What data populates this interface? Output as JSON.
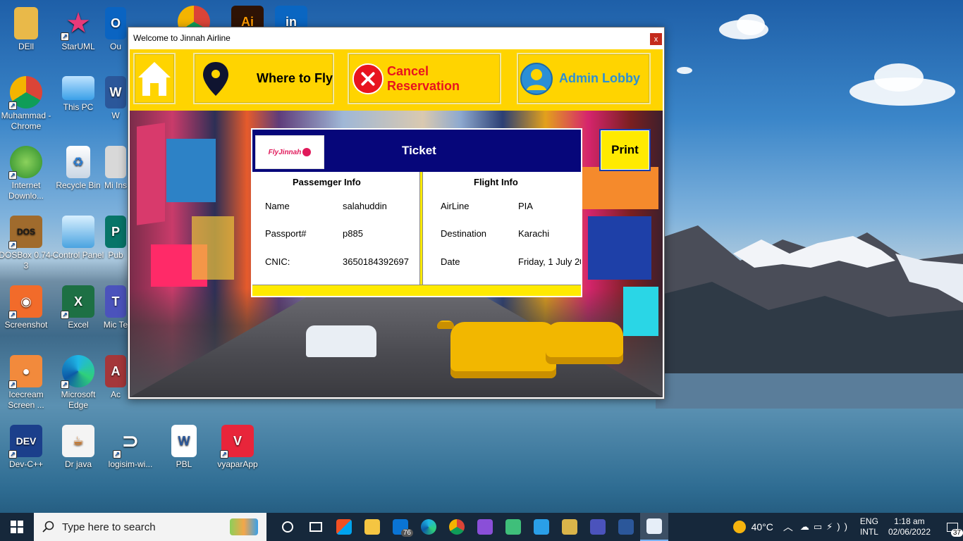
{
  "desktop": {
    "icons": [
      {
        "label": "DEll"
      },
      {
        "label": "StarUML"
      },
      {
        "label": "Ou"
      },
      {
        "label": "Muhammad - Chrome"
      },
      {
        "label": "This PC"
      },
      {
        "label": "W"
      },
      {
        "label": "Internet Downlo..."
      },
      {
        "label": "Recycle Bin"
      },
      {
        "label": "Mi Ins"
      },
      {
        "label": "DOSBox 0.74-3"
      },
      {
        "label": "Control Panel"
      },
      {
        "label": "Pub"
      },
      {
        "label": "Screenshot"
      },
      {
        "label": "Excel"
      },
      {
        "label": "Mic Te"
      },
      {
        "label": "Icecream Screen ..."
      },
      {
        "label": "Microsoft Edge"
      },
      {
        "label": "Ac"
      },
      {
        "label": "Dev-C++"
      },
      {
        "label": "Dr java"
      },
      {
        "label": "logisim-wi..."
      },
      {
        "label": "PBL"
      },
      {
        "label": "vyaparApp"
      }
    ]
  },
  "window": {
    "title": "Welcome to Jinnah Airline",
    "close_label": "x"
  },
  "toolbar": {
    "where_to_fly": "Where to Fly",
    "cancel_reservation": "Cancel Reservation",
    "admin_lobby": "Admin Lobby",
    "colors": {
      "bg": "#ffd400",
      "cancel_text": "#e8141e",
      "admin_text": "#2b8fd6"
    }
  },
  "ticket": {
    "logo_text": "FlyJinnah",
    "title": "Ticket",
    "passenger_title": "Passemger Info",
    "flight_title": "Flight Info",
    "passenger": [
      {
        "label": "Name",
        "value": "salahuddin"
      },
      {
        "label": "Passport#",
        "value": "p885"
      },
      {
        "label": "CNIC:",
        "value": "3650184392697"
      }
    ],
    "flight": [
      {
        "label": "AirLine",
        "value": "PIA"
      },
      {
        "label": "Destination",
        "value": "Karachi"
      },
      {
        "label": "Date",
        "value": "Friday, 1 July 20"
      }
    ],
    "print_label": "Print",
    "colors": {
      "header": "#06067a",
      "accent": "#ffea00"
    }
  },
  "taskbar": {
    "search_placeholder": "Type here to search",
    "mail_badge": "76",
    "weather": "40°C",
    "lang_top": "ENG",
    "lang_bottom": "INTL",
    "time": "1:18 am",
    "date": "02/06/2022",
    "notifications": "37"
  }
}
